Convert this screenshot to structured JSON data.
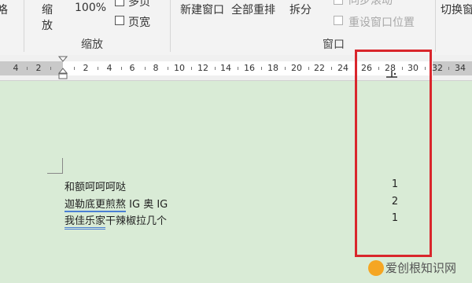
{
  "ribbon": {
    "left_cut_label": "咯",
    "zoom_label_1": "缩",
    "zoom_label_2": "放",
    "zoom_percent": "100%",
    "multipage_label": "多页",
    "page_width_label": "页宽",
    "zoom_group_label": "缩放",
    "new_window_label": "新建窗口",
    "arrange_all_label": "全部重排",
    "split_label": "拆分",
    "sync_scroll_label": "同步滚动",
    "reset_window_label": "重设窗口位置",
    "window_group_label": "窗口",
    "switch_window_label": "切换窗"
  },
  "ruler": {
    "labels": [
      "4",
      "2",
      "2",
      "4",
      "6",
      "8",
      "10",
      "12",
      "14",
      "16",
      "18",
      "20",
      "22",
      "24",
      "26",
      "28",
      "30",
      "32",
      "34"
    ]
  },
  "document": {
    "lines": [
      {
        "text_a": "和额呵呵呵哒",
        "text_b": "",
        "number": "1"
      },
      {
        "text_a": "迦勒底更煎熬",
        "text_b": " IG 奥 IG",
        "number": "2"
      },
      {
        "text_a": "我佳乐家",
        "text_b": "干辣椒拉几个",
        "number": "1"
      }
    ]
  },
  "watermark": {
    "text": "爱创根知识网"
  },
  "colors": {
    "highlight_box": "#d9262c",
    "doc_background": "#d9ebd6"
  }
}
